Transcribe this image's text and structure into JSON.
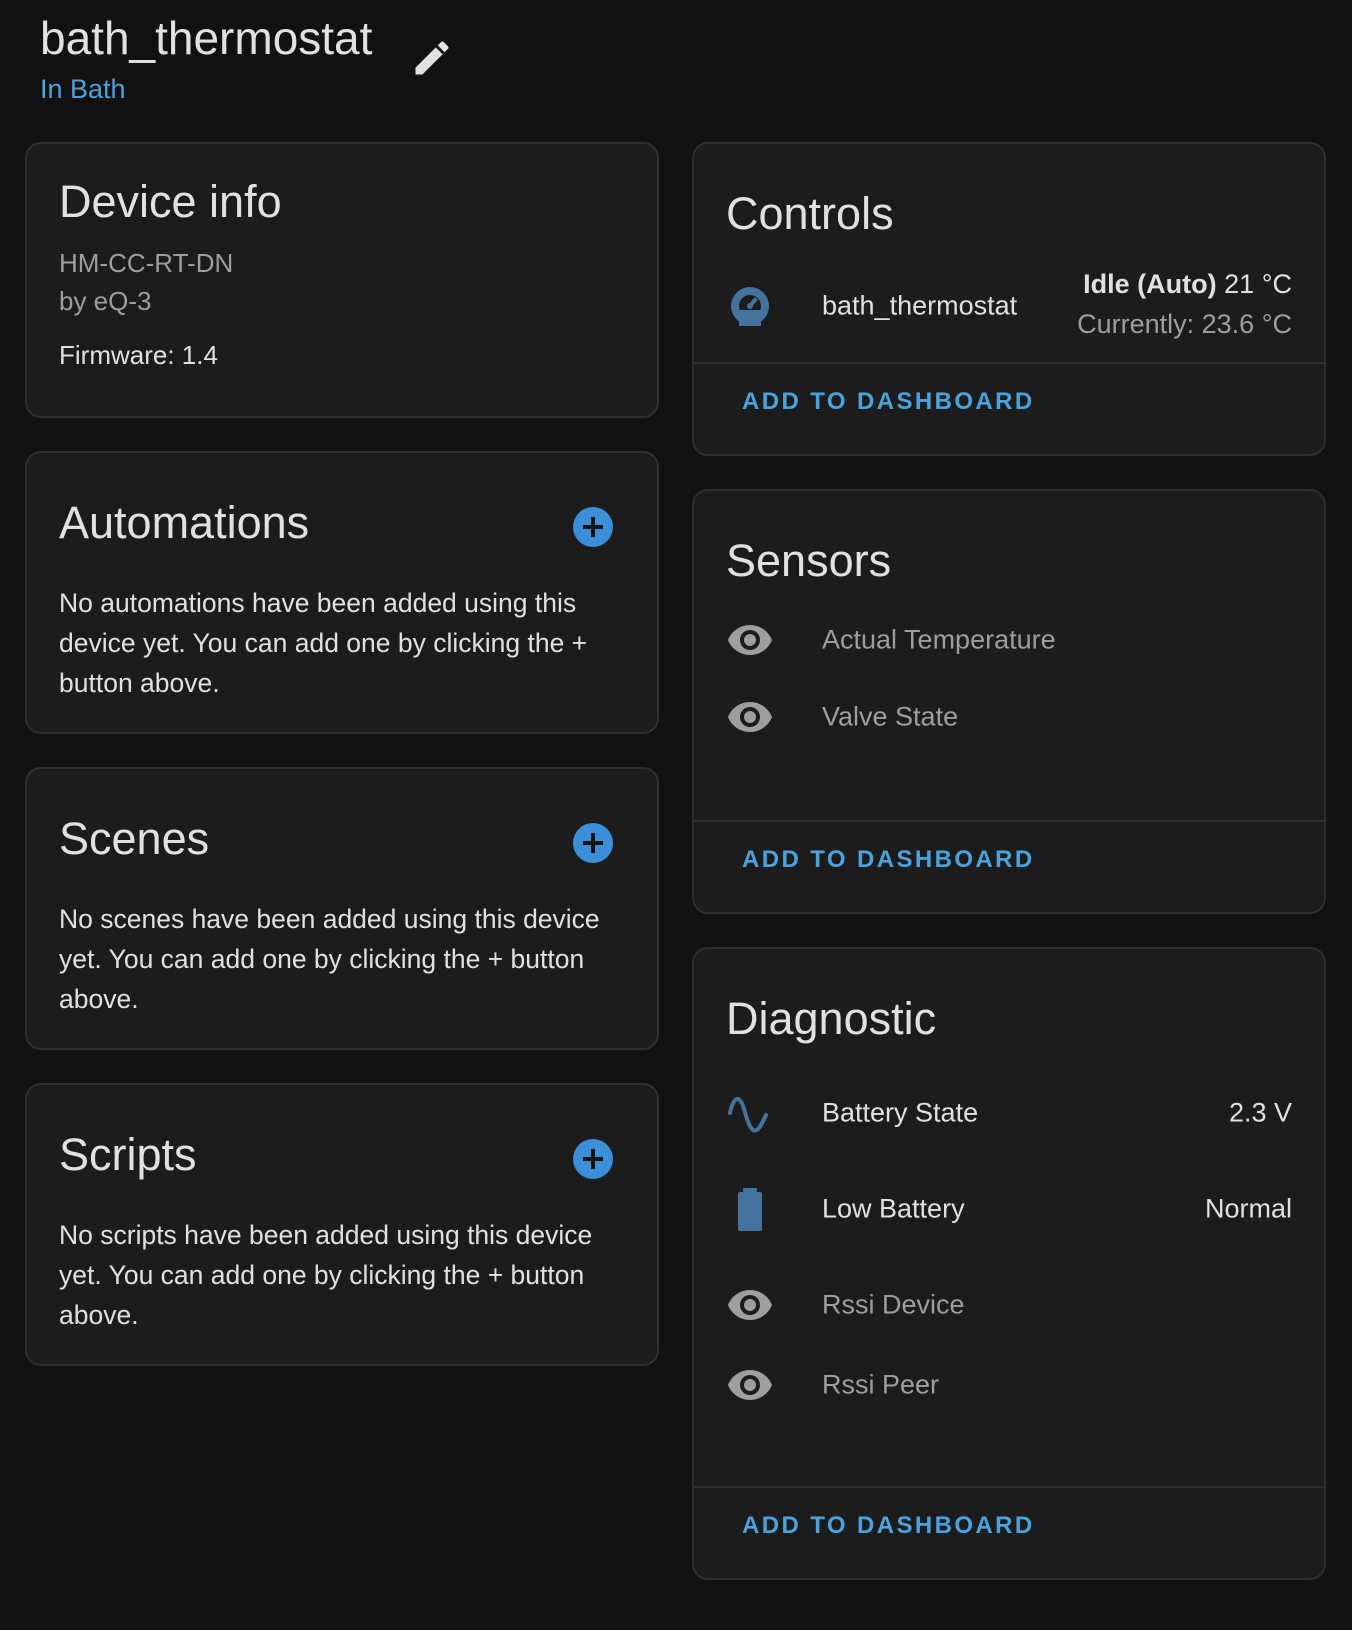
{
  "header": {
    "title": "bath_thermostat",
    "area": "In Bath"
  },
  "device_info": {
    "title": "Device info",
    "model": "HM-CC-RT-DN",
    "manufacturer": "by eQ-3",
    "firmware": "Firmware: 1.4"
  },
  "automations": {
    "title": "Automations",
    "text": "No automations have been added using this device yet. You can add one by clicking the + button above."
  },
  "scenes": {
    "title": "Scenes",
    "text": "No scenes have been added using this device yet. You can add one by clicking the + button above."
  },
  "scripts": {
    "title": "Scripts",
    "text": "No scripts have been added using this device yet. You can add one by clicking the + button above."
  },
  "controls": {
    "title": "Controls",
    "entity_name": "bath_thermostat",
    "state_bold": "Idle (Auto)",
    "state_target": " 21 °C",
    "current": "Currently: 23.6 °C",
    "add_label": "ADD TO DASHBOARD"
  },
  "sensors": {
    "title": "Sensors",
    "items": [
      {
        "name": "Actual Temperature",
        "icon": "eye-icon"
      },
      {
        "name": "Valve State",
        "icon": "eye-icon"
      }
    ],
    "add_label": "ADD TO DASHBOARD"
  },
  "diagnostic": {
    "title": "Diagnostic",
    "items": [
      {
        "name": "Battery State",
        "value": "2.3 V",
        "icon": "sine-wave-icon"
      },
      {
        "name": "Low Battery",
        "value": "Normal",
        "icon": "battery-icon"
      },
      {
        "name": "Rssi Device",
        "value": "",
        "icon": "eye-icon"
      },
      {
        "name": "Rssi Peer",
        "value": "",
        "icon": "eye-icon"
      }
    ],
    "add_label": "ADD TO DASHBOARD"
  },
  "colors": {
    "background": "#111111",
    "card": "#1c1c1c",
    "accent": "#4aa3df",
    "icon_blue": "#44739e",
    "muted": "#9e9e9e"
  }
}
